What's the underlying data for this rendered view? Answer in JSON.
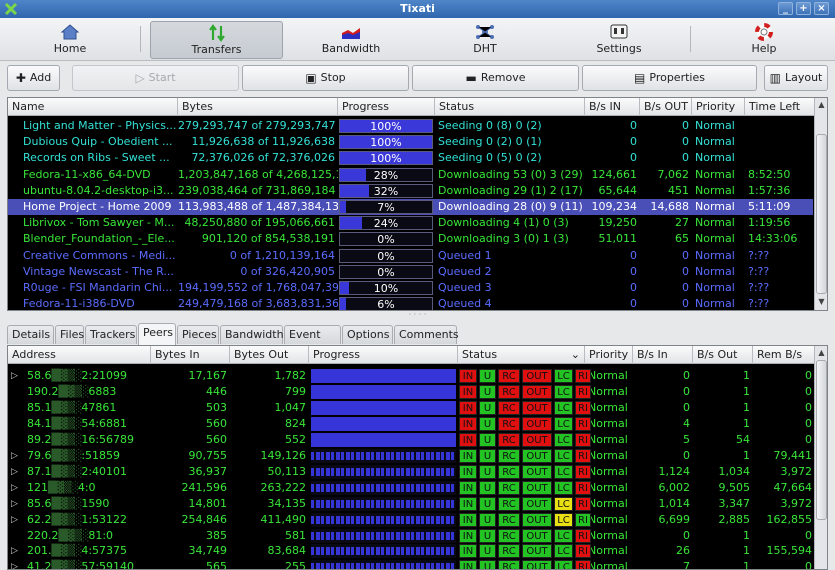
{
  "window": {
    "title": "Tixati"
  },
  "toolbar": {
    "home": "Home",
    "transfers": "Transfers",
    "bandwidth": "Bandwidth",
    "dht": "DHT",
    "settings": "Settings",
    "help": "Help"
  },
  "actions": {
    "add": "Add",
    "start": "Start",
    "stop": "Stop",
    "remove": "Remove",
    "properties": "Properties",
    "layout": "Layout"
  },
  "transfers": {
    "columns": [
      "Name",
      "Bytes",
      "Progress",
      "Status",
      "B/s IN",
      "B/s OUT",
      "Priority",
      "Time Left"
    ],
    "rows": [
      {
        "name": "Light and Matter - Physics...",
        "bytes": "279,293,747 of 279,293,747",
        "progress": "100%",
        "pct": 100,
        "status": "Seeding 0 (8) 0 (2)",
        "in": "0",
        "out": "0",
        "priority": "Normal",
        "time": "",
        "color": "#33e1d6",
        "sel": false
      },
      {
        "name": "Dubious Quip - Obedient ...",
        "bytes": "11,926,638 of 11,926,638",
        "progress": "100%",
        "pct": 100,
        "status": "Seeding 0 (2) 0 (1)",
        "in": "0",
        "out": "0",
        "priority": "Normal",
        "time": "",
        "color": "#33e1d6",
        "sel": false
      },
      {
        "name": "Records on Ribs - Sweet ...",
        "bytes": "72,376,026 of 72,376,026",
        "progress": "100%",
        "pct": 100,
        "status": "Seeding 0 (5) 0 (2)",
        "in": "0",
        "out": "0",
        "priority": "Normal",
        "time": "",
        "color": "#33e1d6",
        "sel": false
      },
      {
        "name": "Fedora-11-x86_64-DVD",
        "bytes": "1,203,847,168 of 4,268,125,1...",
        "progress": "28%",
        "pct": 28,
        "status": "Downloading 53 (0) 3 (29)",
        "in": "124,661",
        "out": "7,062",
        "priority": "Normal",
        "time": "8:52:50",
        "color": "#39e639",
        "sel": false
      },
      {
        "name": "ubuntu-8.04.2-desktop-i3...",
        "bytes": "239,038,464 of 731,869,184",
        "progress": "32%",
        "pct": 32,
        "status": "Downloading 29 (1) 2 (17)",
        "in": "65,644",
        "out": "451",
        "priority": "Normal",
        "time": "1:57:36",
        "color": "#39e639",
        "sel": false
      },
      {
        "name": "Home Project - Home 2009",
        "bytes": "113,983,488 of 1,487,384,13...",
        "progress": "7%",
        "pct": 7,
        "status": "Downloading 28 (0) 9 (11)",
        "in": "109,234",
        "out": "14,688",
        "priority": "Normal",
        "time": "5:11:09",
        "color": "#ffffff",
        "sel": true
      },
      {
        "name": "Librivox - Tom Sawyer - M...",
        "bytes": "48,250,880 of 195,066,661",
        "progress": "24%",
        "pct": 24,
        "status": "Downloading 4 (1) 0 (3)",
        "in": "19,250",
        "out": "27",
        "priority": "Normal",
        "time": "1:19:56",
        "color": "#39e639",
        "sel": false
      },
      {
        "name": "Blender_Foundation_-_Ele...",
        "bytes": "901,120 of 854,538,191",
        "progress": "0%",
        "pct": 0,
        "status": "Downloading 3 (0) 1 (3)",
        "in": "51,011",
        "out": "65",
        "priority": "Normal",
        "time": "14:33:06",
        "color": "#39e639",
        "sel": false
      },
      {
        "name": "Creative Commons - Medi...",
        "bytes": "0 of 1,210,139,164",
        "progress": "0%",
        "pct": 0,
        "status": "Queued 1",
        "in": "0",
        "out": "0",
        "priority": "Normal",
        "time": "?:??",
        "color": "#5a6cff",
        "sel": false
      },
      {
        "name": "Vintage Newscast - The R...",
        "bytes": "0 of 326,420,905",
        "progress": "0%",
        "pct": 0,
        "status": "Queued 2",
        "in": "0",
        "out": "0",
        "priority": "Normal",
        "time": "?:??",
        "color": "#5a6cff",
        "sel": false
      },
      {
        "name": "R0uge - FSI Mandarin Chi...",
        "bytes": "194,199,552 of 1,768,047,39...",
        "progress": "10%",
        "pct": 10,
        "status": "Queued 3",
        "in": "0",
        "out": "0",
        "priority": "Normal",
        "time": "?:??",
        "color": "#5a6cff",
        "sel": false
      },
      {
        "name": "Fedora-11-i386-DVD",
        "bytes": "249,479,168 of 3,683,831,36...",
        "progress": "6%",
        "pct": 6,
        "status": "Queued 4",
        "in": "0",
        "out": "0",
        "priority": "Normal",
        "time": "?:??",
        "color": "#5a6cff",
        "sel": false
      }
    ]
  },
  "tabs": [
    "Details",
    "Files",
    "Trackers",
    "Peers",
    "Pieces",
    "Bandwidth",
    "Event Log",
    "Options",
    "Comments"
  ],
  "peers": {
    "columns": [
      "Address",
      "Bytes In",
      "Bytes Out",
      "Progress",
      "Status",
      "Priority",
      "B/s In",
      "B/s Out",
      "Rem B/s"
    ],
    "rows": [
      {
        "a1": "58.6",
        "a2": "2:21099",
        "bin": "17,167",
        "bout": "1,782",
        "full": true,
        "lc": "grn",
        "in": "red",
        "u": "grn",
        "rc": "red",
        "out": "red",
        "ri": "red",
        "priority": "Normal",
        "bsin": "0",
        "bsout": "1",
        "rem": "0",
        "exp": true
      },
      {
        "a1": "190.2",
        "a2": "6883",
        "bin": "446",
        "bout": "799",
        "full": true,
        "lc": "grn",
        "in": "red",
        "u": "grn",
        "rc": "red",
        "out": "red",
        "ri": "red",
        "priority": "Normal",
        "bsin": "0",
        "bsout": "1",
        "rem": "0",
        "exp": false
      },
      {
        "a1": "85.1",
        "a2": "47861",
        "bin": "503",
        "bout": "1,047",
        "full": true,
        "lc": "grn",
        "in": "red",
        "u": "grn",
        "rc": "red",
        "out": "red",
        "ri": "red",
        "priority": "Normal",
        "bsin": "0",
        "bsout": "1",
        "rem": "0",
        "exp": false
      },
      {
        "a1": "84.1",
        "a2": "54:6881",
        "bin": "560",
        "bout": "824",
        "full": true,
        "lc": "grn",
        "in": "red",
        "u": "grn",
        "rc": "red",
        "out": "red",
        "ri": "red",
        "priority": "Normal",
        "bsin": "4",
        "bsout": "1",
        "rem": "0",
        "exp": false
      },
      {
        "a1": "89.2",
        "a2": "16:56789",
        "bin": "560",
        "bout": "552",
        "full": true,
        "lc": "grn",
        "in": "red",
        "u": "grn",
        "rc": "red",
        "out": "red",
        "ri": "red",
        "priority": "Normal",
        "bsin": "5",
        "bsout": "54",
        "rem": "0",
        "exp": false
      },
      {
        "a1": "79.6",
        "a2": ":51859",
        "bin": "90,755",
        "bout": "149,126",
        "full": false,
        "lc": "grn",
        "in": "grn",
        "u": "grn",
        "rc": "grn",
        "out": "grn",
        "ri": "red",
        "priority": "Normal",
        "bsin": "0",
        "bsout": "1",
        "rem": "79,441",
        "exp": true
      },
      {
        "a1": "87.1",
        "a2": "2:40101",
        "bin": "36,937",
        "bout": "50,113",
        "full": false,
        "lc": "grn",
        "in": "grn",
        "u": "grn",
        "rc": "grn",
        "out": "grn",
        "ri": "red",
        "priority": "Normal",
        "bsin": "1,124",
        "bsout": "1,034",
        "rem": "3,972",
        "exp": true
      },
      {
        "a1": "121",
        "a2": "4:0",
        "bin": "241,596",
        "bout": "263,222",
        "full": false,
        "lc": "grn",
        "in": "grn",
        "u": "grn",
        "rc": "grn",
        "out": "grn",
        "ri": "red",
        "priority": "Normal",
        "bsin": "6,002",
        "bsout": "9,505",
        "rem": "47,664",
        "exp": true
      },
      {
        "a1": "85.6",
        "a2": "1590",
        "bin": "14,801",
        "bout": "34,135",
        "full": false,
        "lc": "yel",
        "in": "grn",
        "u": "grn",
        "rc": "grn",
        "out": "grn",
        "ri": "red",
        "priority": "Normal",
        "bsin": "1,014",
        "bsout": "3,347",
        "rem": "3,972",
        "exp": true
      },
      {
        "a1": "62.2",
        "a2": "1:53122",
        "bin": "254,846",
        "bout": "411,490",
        "full": false,
        "lc": "yel",
        "in": "grn",
        "u": "grn",
        "rc": "grn",
        "out": "grn",
        "ri": "grn",
        "priority": "Normal",
        "bsin": "6,699",
        "bsout": "2,885",
        "rem": "162,855",
        "exp": true
      },
      {
        "a1": "220.2",
        "a2": "81:0",
        "bin": "385",
        "bout": "581",
        "full": false,
        "lc": "grn",
        "in": "grn",
        "u": "grn",
        "rc": "grn",
        "out": "grn",
        "ri": "red",
        "priority": "Normal",
        "bsin": "0",
        "bsout": "1",
        "rem": "0",
        "exp": false
      },
      {
        "a1": "201.",
        "a2": "4:57375",
        "bin": "34,749",
        "bout": "83,684",
        "full": false,
        "lc": "grn",
        "in": "grn",
        "u": "grn",
        "rc": "grn",
        "out": "grn",
        "ri": "red",
        "priority": "Normal",
        "bsin": "26",
        "bsout": "1",
        "rem": "155,594",
        "exp": true
      },
      {
        "a1": "41.2",
        "a2": "57:59140",
        "bin": "565",
        "bout": "255",
        "full": false,
        "lc": "grn",
        "in": "grn",
        "u": "grn",
        "rc": "grn",
        "out": "grn",
        "ri": "red",
        "priority": "Normal",
        "bsin": "7",
        "bsout": "1",
        "rem": "0",
        "exp": true
      }
    ]
  },
  "status_labels": {
    "in": "IN",
    "u": "U",
    "rc": "RC",
    "out": "OUT",
    "lc": "LC",
    "ri": "RI"
  },
  "colors": {
    "grid_bg": "#000000",
    "accent_blue": "#3a38d8",
    "selected_row": "#4a4fb8",
    "seeding": "#33e1d6",
    "downloading": "#39e639",
    "queued": "#5a6cff"
  }
}
